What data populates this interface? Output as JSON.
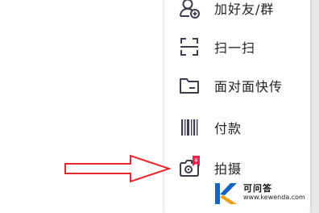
{
  "menu": {
    "items": [
      {
        "label": "加好友/群",
        "icon": "add-friend-icon"
      },
      {
        "label": "扫一扫",
        "icon": "scan-icon"
      },
      {
        "label": "面对面快传",
        "icon": "folder-transfer-icon"
      },
      {
        "label": "付款",
        "icon": "barcode-icon"
      },
      {
        "label": "拍摄",
        "icon": "camera-icon",
        "badge": "¥"
      }
    ]
  },
  "annotation": {
    "arrow_color": "#e8262d"
  },
  "watermark": {
    "name": "可问答",
    "url": "www.kewenda.com",
    "logo_letter": "K"
  },
  "colors": {
    "icon": "#3d3d4f",
    "badge": "#e5234b",
    "arrow": "#e8262d",
    "logo_orange": "#f29b16",
    "logo_blue": "#1565c0"
  }
}
